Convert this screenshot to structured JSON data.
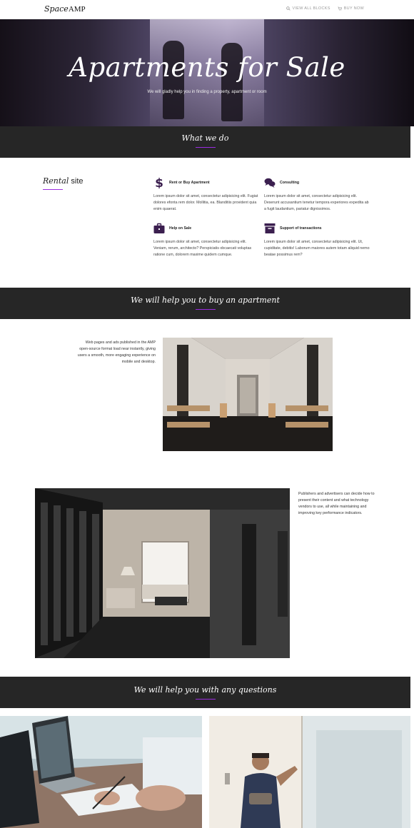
{
  "header": {
    "logo_italic": "Space",
    "logo_rest": "AMP",
    "nav": [
      {
        "label": "VIEW ALL BLOCKS",
        "icon": "search-icon"
      },
      {
        "label": "BUY NOW",
        "icon": "cart-icon"
      }
    ]
  },
  "hero": {
    "title": "Apartments for Sale",
    "subtitle": "We will gladly help you in finding a property, apartment or room"
  },
  "section_what": {
    "title": "What we do"
  },
  "rental": {
    "title_italic": "Rental",
    "title_rest": " site"
  },
  "features": [
    {
      "title": "Rent or Buy Apartment",
      "icon": "dollar-icon",
      "text": "Lorem ipsum dolor sit amet, consectetur adipisicing elit. Fugiat dolores efonta rem dolor. Mollitia, ea. Blanditiis provident quia enim quaerat."
    },
    {
      "title": "Consulting",
      "icon": "chat-icon",
      "text": "Lorem ipsum dolor sit amet, consectetur adipisicing elit. Deserunt accusantium tenetur tempora experiores expedita ab a fugit laudantium, pariatur dignissimos."
    },
    {
      "title": "Help on Sale",
      "icon": "briefcase-icon",
      "text": "Lorem ipsum dolor sit amet, consectetur adipisicing elit. Veniam, rerum, architecto? Perspiciatis obcaecati voluptas ratione cum, dolorem maxime quidem cumque."
    },
    {
      "title": "Support of transactions",
      "icon": "archive-icon",
      "text": "Lorem ipsum dolor sit amet, consectetur adipisicing elit. Ut, cupiditate, debitis! Laborum maiores autem totam aliquid nemo beatae possimus rem?"
    }
  ],
  "section_buy": {
    "title": "We will help you to buy an apartment"
  },
  "block1": {
    "text": "Web pages and ads published in the AMP open-source format load near instantly, giving users a smooth, more engaging experience on mobile and desktop."
  },
  "block2": {
    "text": "Publishers and advertisers can decide how to present their content and what technology vendors to use, all while maintaining and improving key performance indicators."
  },
  "section_questions": {
    "title": "We will help you with any questions"
  },
  "colors": {
    "accent": "#9b2ce0",
    "dark": "#262626",
    "icon": "#3b1f4f"
  }
}
